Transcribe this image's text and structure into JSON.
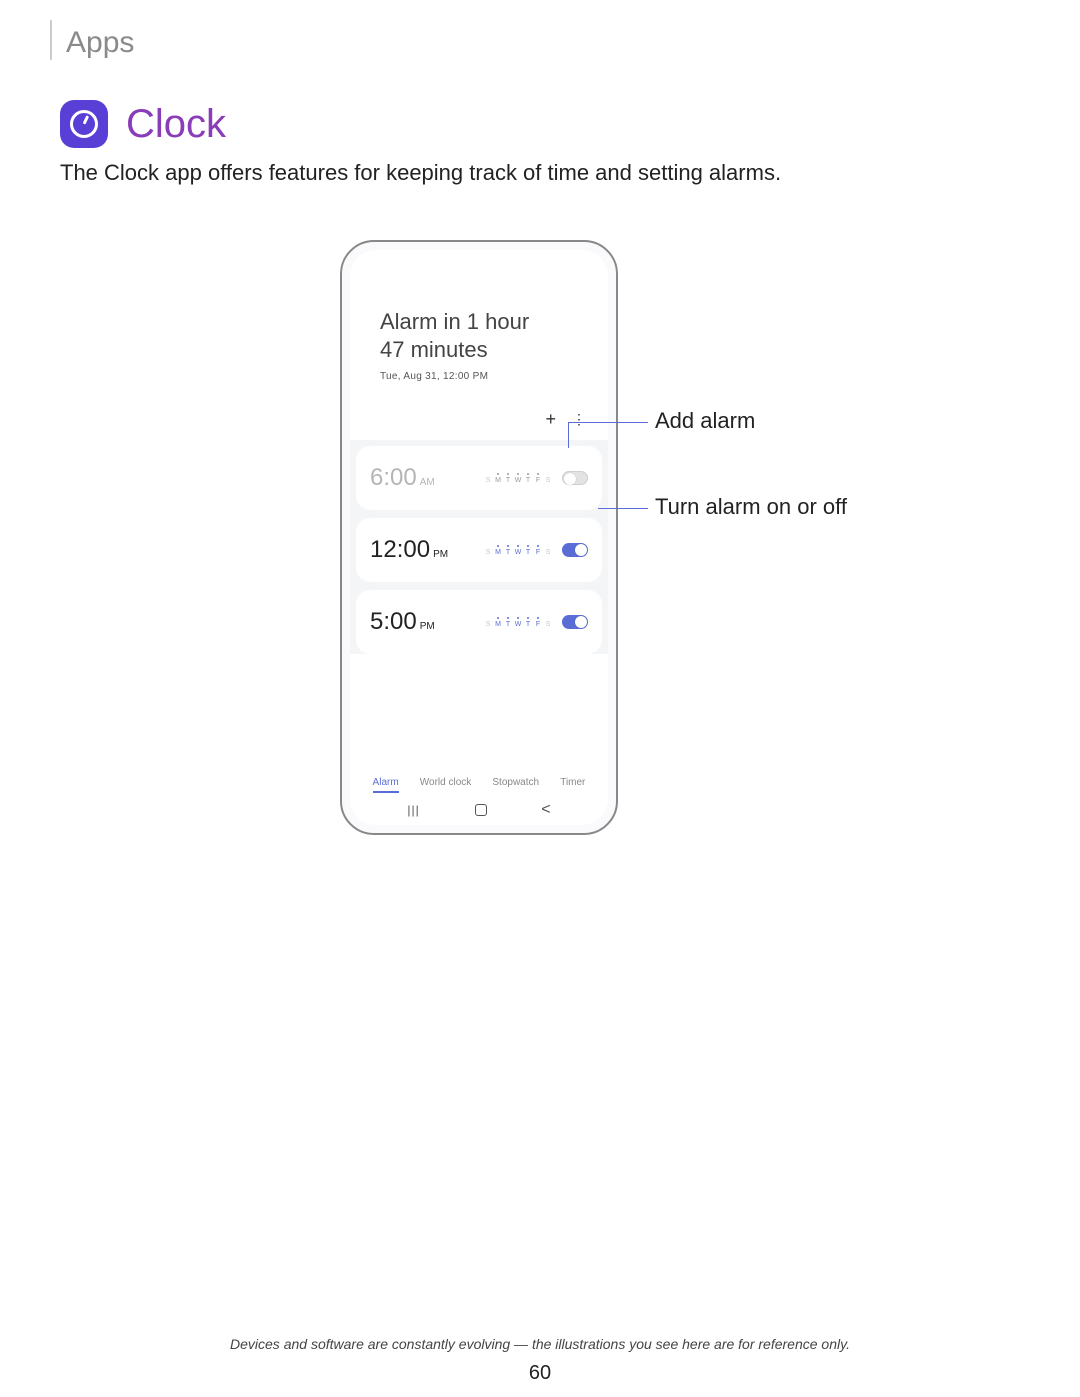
{
  "header": {
    "section": "Apps"
  },
  "app": {
    "title": "Clock",
    "description": "The Clock app offers features for keeping track of time and setting alarms."
  },
  "phone": {
    "hero": {
      "line1": "Alarm in 1 hour",
      "line2": "47 minutes",
      "datetime": "Tue, Aug 31, 12:00 PM"
    },
    "toolbar": {
      "add": "+",
      "more": "⋮"
    },
    "day_letters": [
      "S",
      "M",
      "T",
      "W",
      "T",
      "F",
      "S"
    ],
    "alarms": [
      {
        "time": "6:00",
        "ampm": "AM",
        "on": false,
        "days_active": [
          false,
          true,
          true,
          true,
          true,
          true,
          false
        ]
      },
      {
        "time": "12:00",
        "ampm": "PM",
        "on": true,
        "days_active": [
          false,
          true,
          true,
          true,
          true,
          true,
          false
        ]
      },
      {
        "time": "5:00",
        "ampm": "PM",
        "on": true,
        "days_active": [
          false,
          true,
          true,
          true,
          true,
          true,
          false
        ]
      }
    ],
    "tabs": [
      "Alarm",
      "World clock",
      "Stopwatch",
      "Timer"
    ],
    "active_tab": 0,
    "nav": {
      "recents": "|||",
      "back": "<"
    }
  },
  "callouts": {
    "add_alarm": "Add alarm",
    "toggle_alarm": "Turn alarm on or off"
  },
  "footer": {
    "note": "Devices and software are constantly evolving — the illustrations you see here are for reference only.",
    "page": "60"
  }
}
